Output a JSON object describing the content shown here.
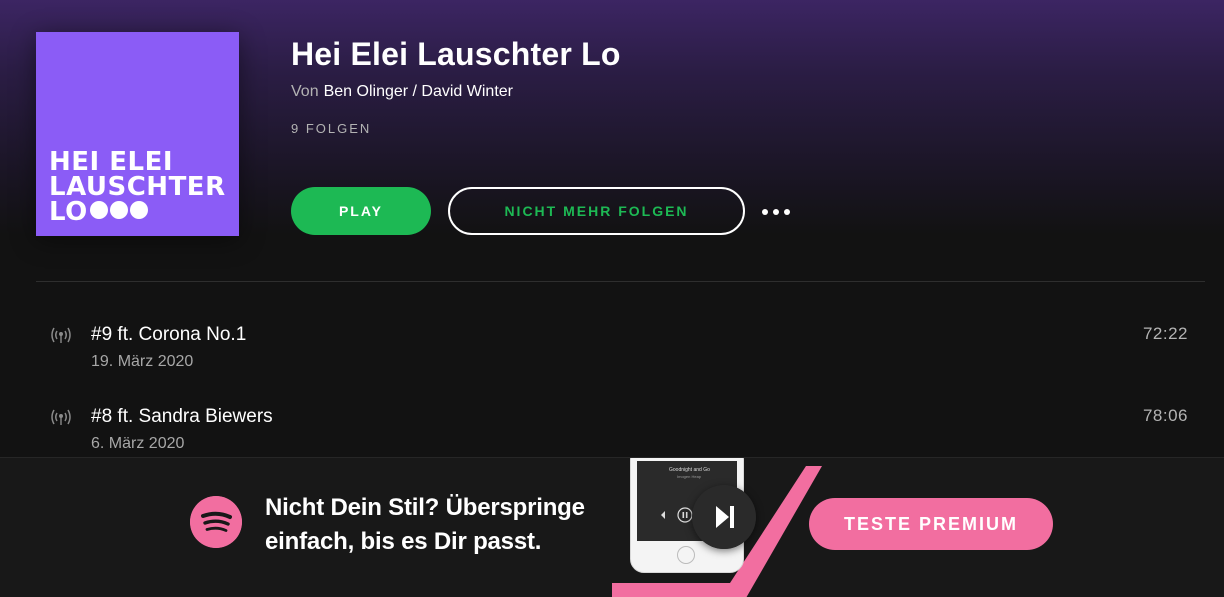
{
  "podcast": {
    "cover": {
      "line1": "HEI ELEI",
      "line2": "LAUSCHTER",
      "line3": "LO",
      "color": "#8b5cf6"
    },
    "title": "Hei Elei Lauschter Lo",
    "by_prefix": "Von",
    "authors": "Ben Olinger / David Winter",
    "episode_count": "9 FOLGEN"
  },
  "actions": {
    "play_label": "PLAY",
    "unfollow_label": "NICHT MEHR FOLGEN",
    "more_icon": "ellipsis-icon"
  },
  "episodes": [
    {
      "title": "#9 ft. Corona No.1",
      "date": "19. März 2020",
      "duration": "72:22",
      "icon": "podcast-broadcast-icon"
    },
    {
      "title": "#8 ft. Sandra Biewers",
      "date": "6. März 2020",
      "duration": "78:06",
      "icon": "podcast-broadcast-icon"
    }
  ],
  "banner": {
    "line1": "Nicht Dein Stil? Überspringe",
    "line2": "einfach, bis es Dir passt.",
    "cta_label": "TESTE PREMIUM",
    "phone_song": "Goodnight and Go",
    "phone_artist": "Imogen Heap",
    "logo_icon": "spotify-icon",
    "skip_icon": "skip-next-icon"
  },
  "colors": {
    "accent_green": "#1db954",
    "premium_pink": "#f26ea0",
    "header_purple": "#3c2563",
    "background": "#121212"
  }
}
